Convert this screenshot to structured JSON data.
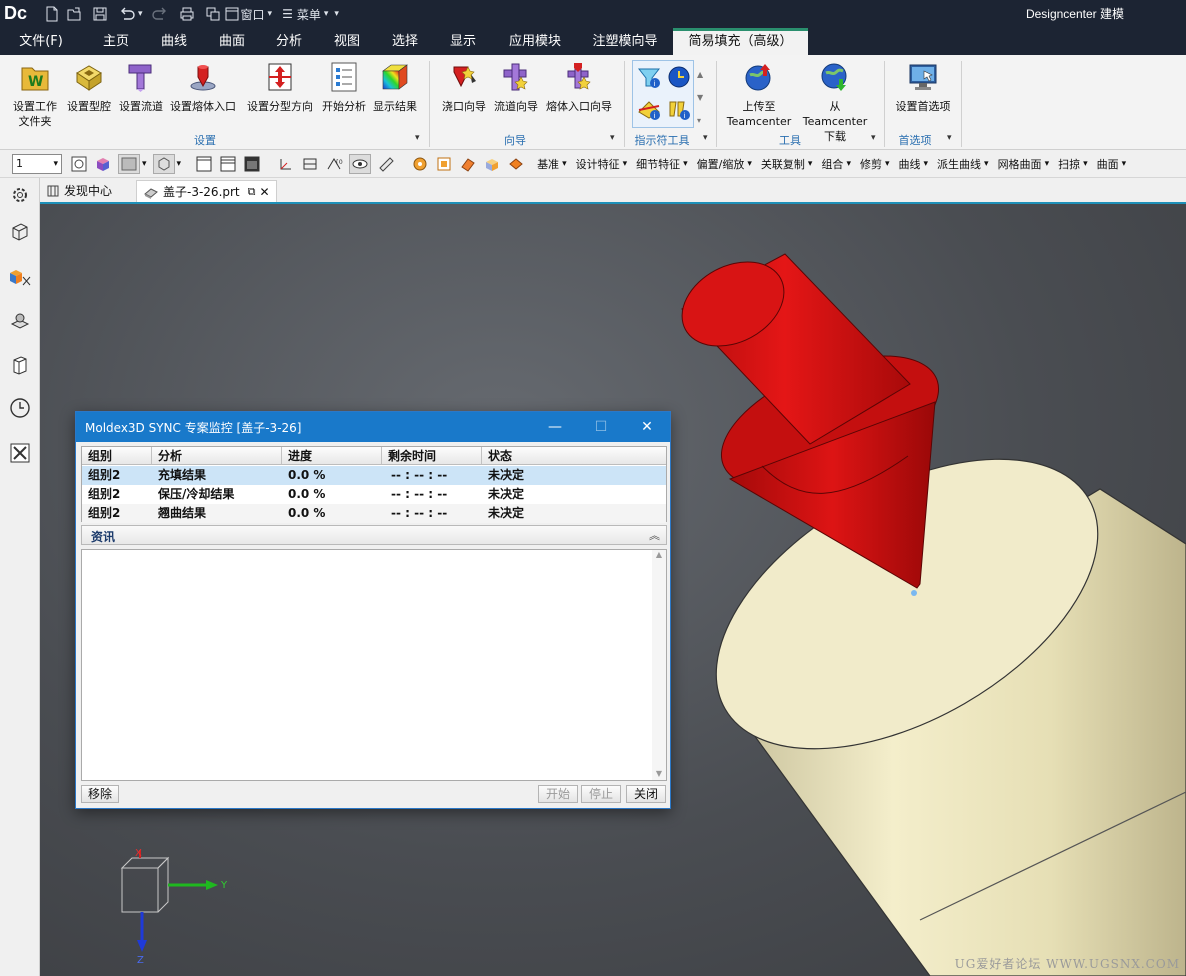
{
  "titlebar": {
    "logo": "Dc",
    "app_title": "Designcenter 建模",
    "window_dropdown": "窗口",
    "menu_dropdown": "菜单"
  },
  "menubar": {
    "file": "文件(F)",
    "tabs": [
      "主页",
      "曲线",
      "曲面",
      "分析",
      "视图",
      "选择",
      "显示",
      "应用模块",
      "注塑模向导",
      "简易填充（高级）"
    ],
    "active_tab": "简易填充（高级）"
  },
  "ribbon": {
    "setup_buttons": [
      {
        "label": "设置工作\n文件夹",
        "icon": "workfolder-icon"
      },
      {
        "label": "设置型腔",
        "icon": "cavity-icon"
      },
      {
        "label": "设置流道",
        "icon": "runner-icon"
      },
      {
        "label": "设置熔体入口",
        "icon": "melt-entrance-icon"
      },
      {
        "label": "设置分型方向",
        "icon": "parting-direction-icon"
      },
      {
        "label": "开始分析",
        "icon": "start-analysis-icon"
      },
      {
        "label": "显示结果",
        "icon": "show-results-icon"
      }
    ],
    "setup_group": "设置",
    "wizard_buttons": [
      {
        "label": "浇口向导",
        "icon": "gate-wizard-icon"
      },
      {
        "label": "流道向导",
        "icon": "runner-wizard-icon"
      },
      {
        "label": "熔体入口向导",
        "icon": "melt-entrance-wizard-icon"
      }
    ],
    "wizard_group": "向导",
    "indicator_group": "指示符工具",
    "tools_buttons": [
      {
        "label": "上传至\nTeamcenter",
        "icon": "upload-teamcenter-icon"
      },
      {
        "label": "从 Teamcenter\n下载",
        "icon": "download-teamcenter-icon"
      }
    ],
    "tools_group": "工具",
    "pref_button": {
      "label": "设置首选项",
      "icon": "preferences-icon"
    },
    "pref_group": "首选项"
  },
  "toolbar": {
    "layer_value": "1",
    "dropdowns": [
      "基准",
      "设计特征",
      "细节特征",
      "偏置/缩放",
      "关联复制",
      "组合",
      "修剪",
      "曲线",
      "派生曲线",
      "网格曲面",
      "扫掠",
      "曲面"
    ]
  },
  "doctabs": {
    "discovery": "发现中心",
    "part": "盖子-3-26.prt"
  },
  "dialog": {
    "title": "Moldex3D SYNC 专案监控 [盖子-3-26]",
    "columns": [
      "组别",
      "分析",
      "进度",
      "剩余时间",
      "状态"
    ],
    "rows": [
      {
        "group": "组别2",
        "analysis": "充填结果",
        "progress": "0.0 %",
        "remaining": "-- : -- : --",
        "status": "未决定"
      },
      {
        "group": "组别2",
        "analysis": "保压/冷却结果",
        "progress": "0.0 %",
        "remaining": "-- : -- : --",
        "status": "未决定"
      },
      {
        "group": "组别2",
        "analysis": "翘曲结果",
        "progress": "0.0 %",
        "remaining": "-- : -- : --",
        "status": "未决定"
      }
    ],
    "info_header": "资讯",
    "remove_label": "移除",
    "start_label": "开始",
    "stop_label": "停止",
    "close_label": "关闭"
  },
  "viewport": {
    "axis_x": "X",
    "axis_y": "Y",
    "axis_z": "Z",
    "watermark": "UG爱好者论坛 WWW.UGSNX.COM",
    "colors": {
      "arrow": "#d41010",
      "part": "#efe7bd",
      "background": "#4a4d52"
    }
  }
}
